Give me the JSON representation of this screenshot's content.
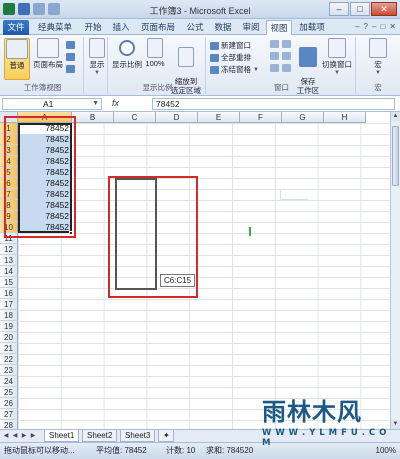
{
  "window": {
    "title": "工作簿3 - Microsoft Excel",
    "minimize": "–",
    "maximize": "□",
    "close": "✕"
  },
  "ribbon_tabs": [
    "文件",
    "经典菜单",
    "开始",
    "插入",
    "页面布局",
    "公式",
    "数据",
    "审阅",
    "视图",
    "加载项"
  ],
  "ribbon_tabs_active": "视图",
  "ribbon_right": {
    "help": "?",
    "min": "–",
    "restore": "□",
    "close": "✕"
  },
  "ribbon": {
    "group_workbook_view": {
      "label": "工作簿视图",
      "normal": "普通",
      "page_layout": "页面布局"
    },
    "group_show": {
      "show": "显示"
    },
    "group_zoom": {
      "label": "显示比例",
      "zoom": "显示比例",
      "hundred": "100%",
      "zoom_selection": "缩放到\n选定区域"
    },
    "group_window": {
      "label": "窗口",
      "new_window": "新建窗口",
      "arrange_all": "全部重排",
      "freeze_panes": "冻结窗格",
      "save_workspace": "保存\n工作区",
      "switch_windows": "切换窗口"
    },
    "group_macros": {
      "label": "宏",
      "macros": "宏"
    }
  },
  "formula_bar": {
    "name_box": "A1",
    "fx": "fx",
    "value": "78452"
  },
  "grid": {
    "columns": [
      "A",
      "B",
      "C",
      "D",
      "E",
      "F",
      "G",
      "H"
    ],
    "rows": [
      "1",
      "2",
      "3",
      "4",
      "5",
      "6",
      "7",
      "8",
      "9",
      "10",
      "11",
      "12",
      "13",
      "14",
      "15",
      "16",
      "17",
      "18",
      "19",
      "20",
      "21",
      "22",
      "23",
      "24",
      "25",
      "26",
      "27",
      "28"
    ],
    "a_values": [
      "78452",
      "78452",
      "78452",
      "78452",
      "78452",
      "78452",
      "78452",
      "78452",
      "78452",
      "78452"
    ],
    "drag_tooltip": "C6:C15"
  },
  "sheets": [
    "Sheet1",
    "Sheet2",
    "Sheet3"
  ],
  "status": {
    "hint": "拖动鼠标可以移动...",
    "average": "平均值: 78452",
    "count": "计数: 10",
    "sum": "求和: 784520",
    "zoom": "100%"
  },
  "watermark": {
    "text": "雨林木风",
    "url": "W W W . Y L M F U . C O M"
  },
  "colors": {
    "selection_fill": "#c7daf0",
    "highlight_box": "#d42a2a",
    "header_selected": "#f5c35e",
    "file_tab": "#1f5aa8"
  }
}
